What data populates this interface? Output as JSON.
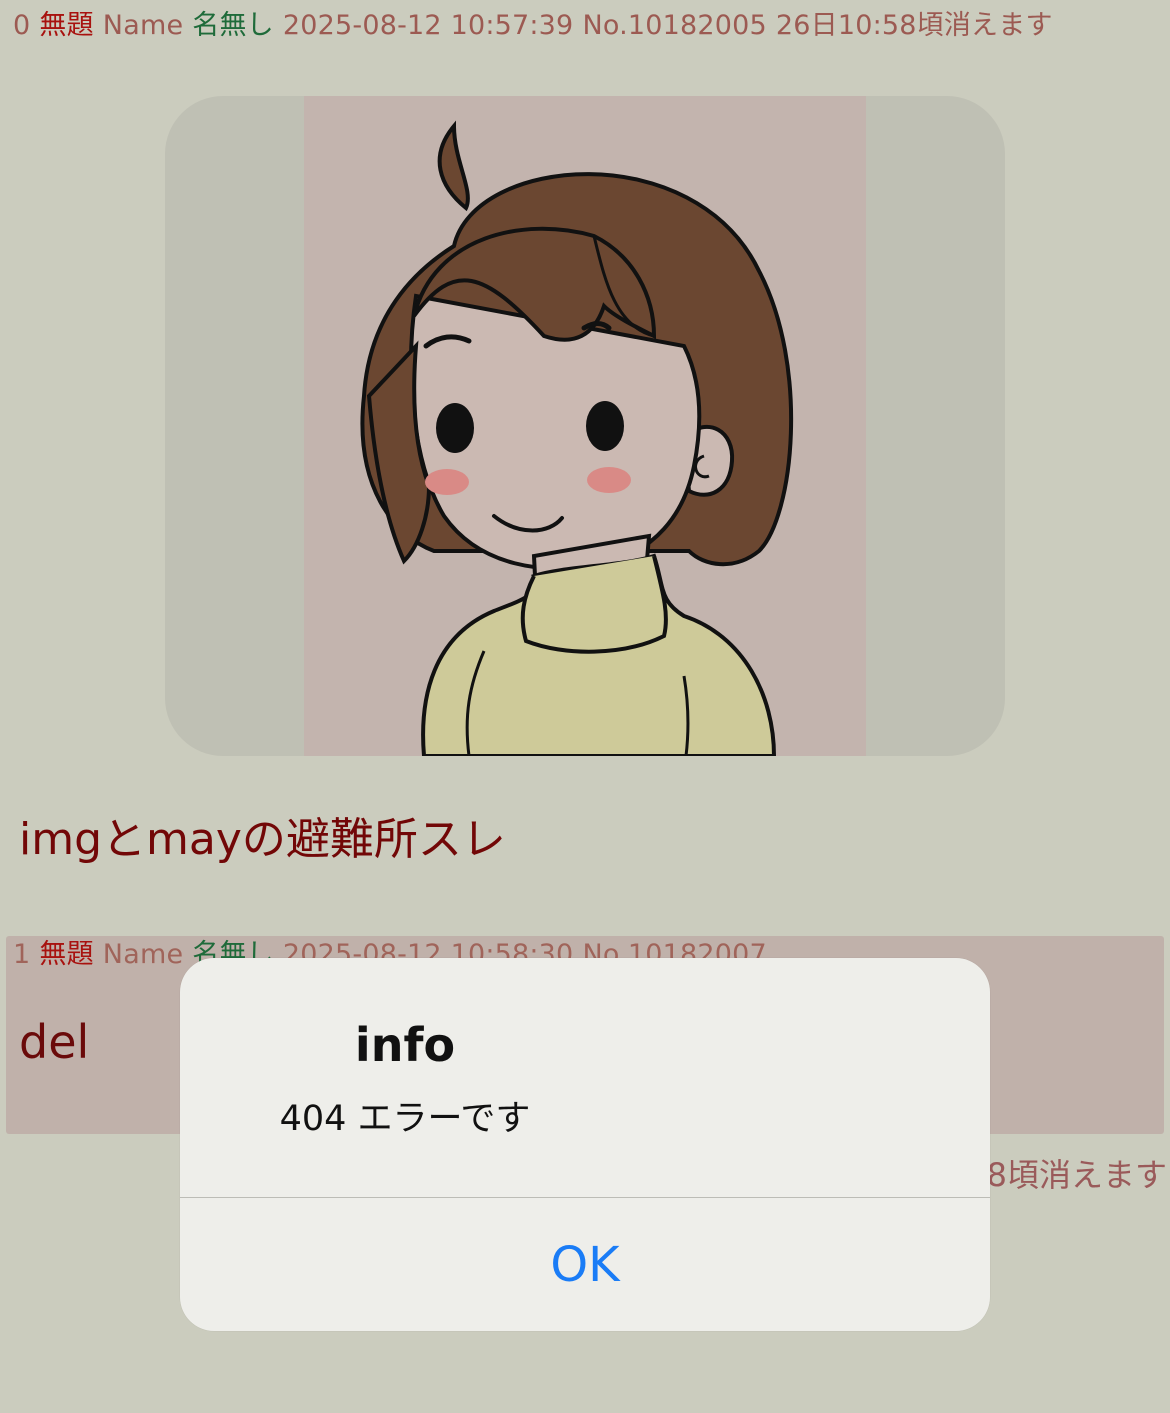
{
  "post0": {
    "number": "0",
    "subject": "無題",
    "name_label": "Name",
    "name": "名無し",
    "datetime": "2025-08-12 10:57:39",
    "post_no": "No.10182005",
    "expiry": "26日10:58頃消えます"
  },
  "thread_title": "imgとmayの避難所スレ",
  "post1": {
    "number": "1",
    "subject": "無題",
    "name_label": "Name",
    "name": "名無し",
    "datetime": "2025-08-12 10:58:30",
    "post_no": "No.10182007",
    "body": "del"
  },
  "post2_partial_expiry": "8頃消えます",
  "alert": {
    "title": "info",
    "message": "404 エラーです",
    "ok_label": "OK"
  },
  "colors": {
    "background": "#cbccbe",
    "subject": "#a8120f",
    "name": "#1f6b3a",
    "body_text": "#720707",
    "reply_bg": "#c0b1aa",
    "alert_button": "#1a7cf6"
  },
  "image": {
    "alt": "thumbnail-image"
  }
}
